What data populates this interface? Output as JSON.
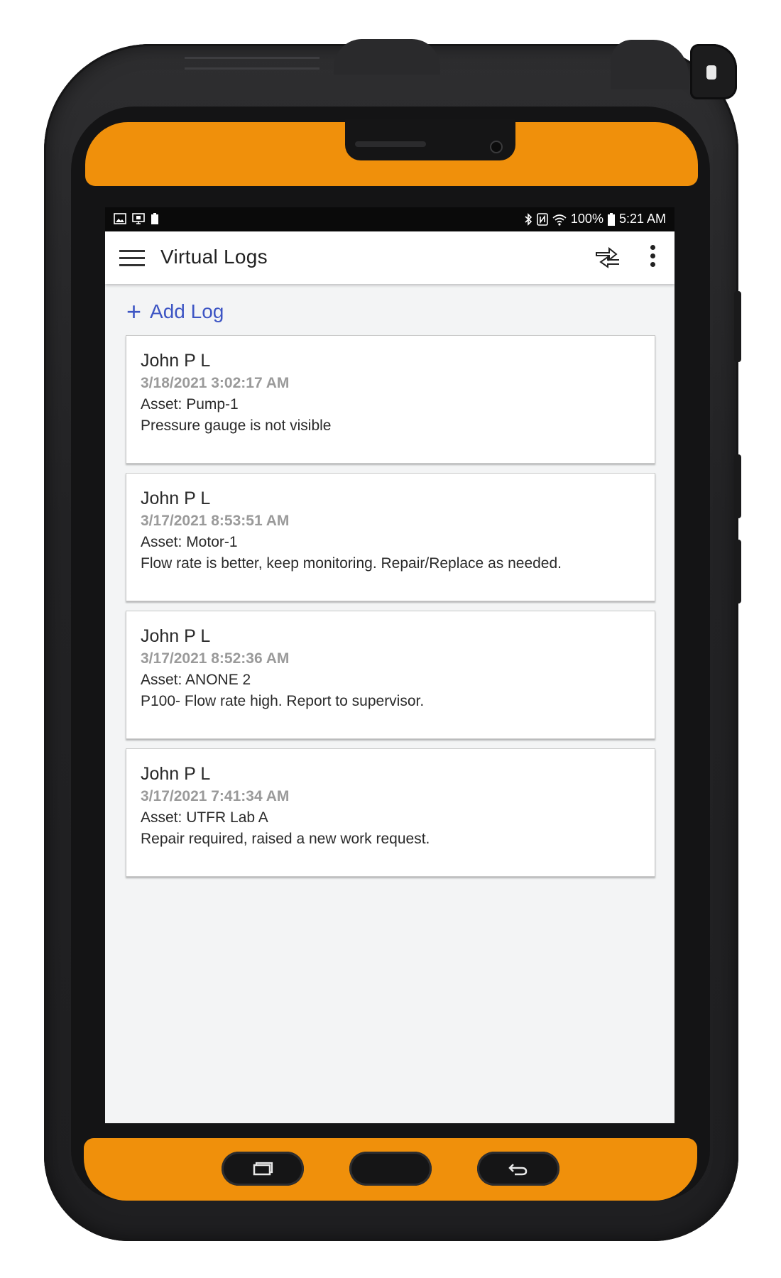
{
  "status_bar": {
    "battery_percent": "100%",
    "time": "5:21 AM",
    "left_icons": [
      "image-icon",
      "cast-icon",
      "battery-saver-icon"
    ],
    "right_icons": [
      "bluetooth-icon",
      "nfc-icon",
      "wifi-icon",
      "battery-icon"
    ]
  },
  "app_bar": {
    "title": "Virtual Logs",
    "icons": [
      "menu-icon",
      "sync-icon",
      "more-vert-icon"
    ]
  },
  "add_log": {
    "label": "Add Log",
    "plus": "+"
  },
  "logs": [
    {
      "user": "John P L",
      "timestamp": "3/18/2021 3:02:17 AM",
      "asset": "Asset: Pump-1",
      "note": "Pressure gauge is not visible"
    },
    {
      "user": "John P L",
      "timestamp": "3/17/2021 8:53:51 AM",
      "asset": "Asset: Motor-1",
      "note": "Flow rate is better, keep monitoring. Repair/Replace as needed."
    },
    {
      "user": "John P L",
      "timestamp": "3/17/2021 8:52:36 AM",
      "asset": "Asset: ANONE 2",
      "note": "P100- Flow rate high. Report to supervisor."
    },
    {
      "user": "John P L",
      "timestamp": "3/17/2021 7:41:34 AM",
      "asset": "Asset: UTFR Lab A",
      "note": "Repair required, raised a new work request."
    }
  ],
  "colors": {
    "accent": "#3d55c4",
    "device_orange": "#f0900b",
    "device_body": "#232325",
    "screen_background": "#f3f4f5",
    "timestamp_gray": "#9a9a9a"
  }
}
